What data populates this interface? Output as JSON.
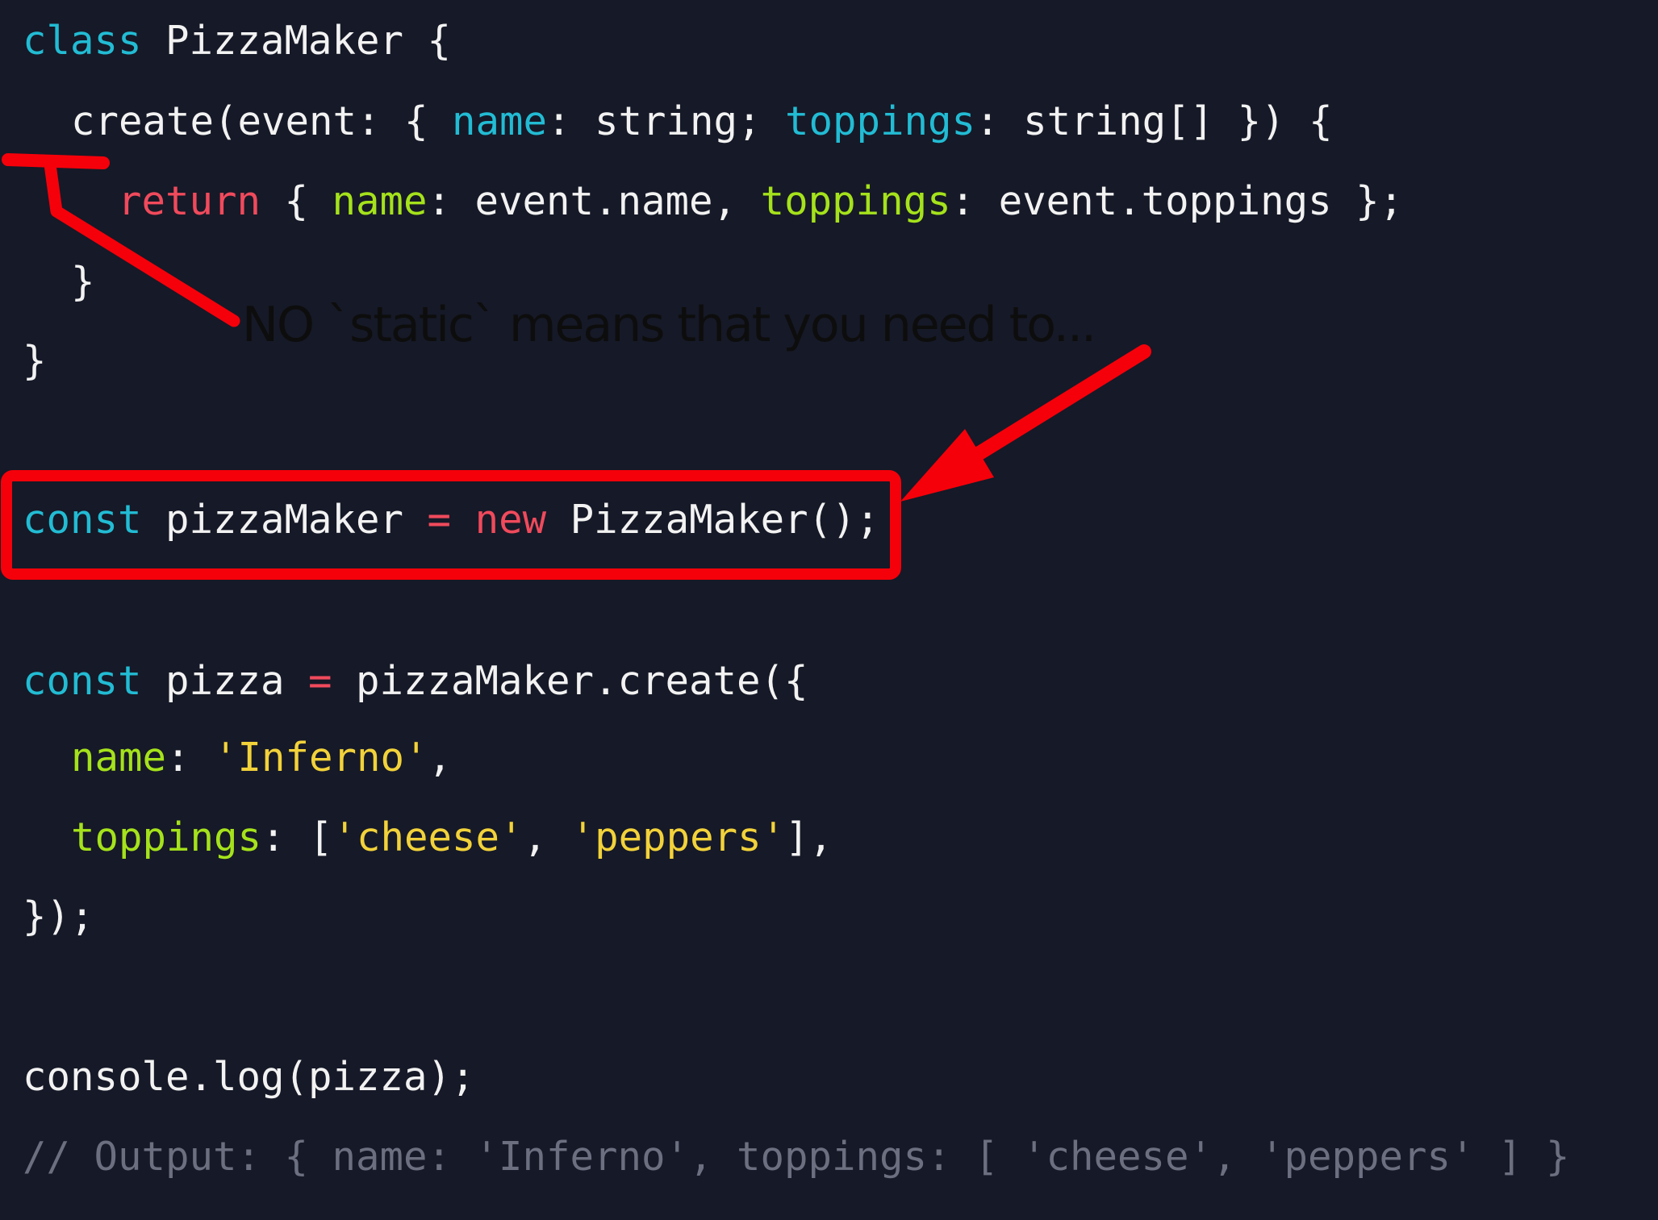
{
  "colors": {
    "background": "#161927",
    "keyword_blue": "#22bcd4",
    "keyword_red": "#f04a5c",
    "property_green": "#a5e21b",
    "string_yellow": "#f2d23a",
    "text": "#f2f2f2",
    "comment": "#6b6f7f",
    "annotation_red": "#f5000a",
    "annotation_text": "#0d0d0d"
  },
  "code": {
    "line1": {
      "kw": "class",
      "rest": " PizzaMaker {"
    },
    "line2": {
      "a": "create(event: { ",
      "name": "name",
      "b": ": string; ",
      "toppings": "toppings",
      "c": ": string[] }) {"
    },
    "line3": {
      "kw": "return",
      "a": " { ",
      "name": "name",
      "b": ": event.name, ",
      "toppings": "toppings",
      "c": ": event.toppings };"
    },
    "line4": "}",
    "line5": "}",
    "line6": {
      "kw": "const",
      "a": " pizzaMaker ",
      "eq": "=",
      "sp": " ",
      "new": "new",
      "b": " PizzaMaker();"
    },
    "line7": {
      "kw": "const",
      "a": " pizza ",
      "eq": "=",
      "b": " pizzaMaker.create({"
    },
    "line8": {
      "prop": "name",
      "a": ": ",
      "str": "'Inferno'",
      "b": ","
    },
    "line9": {
      "prop": "toppings",
      "a": ": [",
      "str1": "'cheese'",
      "b": ", ",
      "str2": "'peppers'",
      "c": "],"
    },
    "line10": "});",
    "line11": "console.log(pizza);",
    "line12": "// Output: { name: 'Inferno', toppings: [ 'cheese', 'peppers' ] }"
  },
  "annotation": {
    "text": "NO `static` means that you need to..."
  }
}
